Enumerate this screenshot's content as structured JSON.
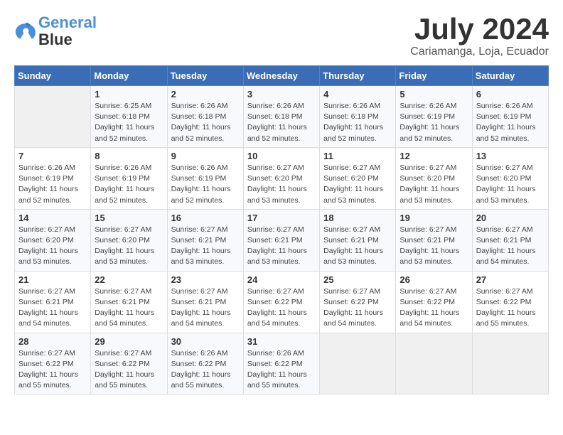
{
  "header": {
    "logo_line1": "General",
    "logo_line2": "Blue",
    "title": "July 2024",
    "location": "Cariamanga, Loja, Ecuador"
  },
  "days_of_week": [
    "Sunday",
    "Monday",
    "Tuesday",
    "Wednesday",
    "Thursday",
    "Friday",
    "Saturday"
  ],
  "weeks": [
    [
      {
        "num": "",
        "info": ""
      },
      {
        "num": "1",
        "info": "Sunrise: 6:25 AM\nSunset: 6:18 PM\nDaylight: 11 hours\nand 52 minutes."
      },
      {
        "num": "2",
        "info": "Sunrise: 6:26 AM\nSunset: 6:18 PM\nDaylight: 11 hours\nand 52 minutes."
      },
      {
        "num": "3",
        "info": "Sunrise: 6:26 AM\nSunset: 6:18 PM\nDaylight: 11 hours\nand 52 minutes."
      },
      {
        "num": "4",
        "info": "Sunrise: 6:26 AM\nSunset: 6:18 PM\nDaylight: 11 hours\nand 52 minutes."
      },
      {
        "num": "5",
        "info": "Sunrise: 6:26 AM\nSunset: 6:19 PM\nDaylight: 11 hours\nand 52 minutes."
      },
      {
        "num": "6",
        "info": "Sunrise: 6:26 AM\nSunset: 6:19 PM\nDaylight: 11 hours\nand 52 minutes."
      }
    ],
    [
      {
        "num": "7",
        "info": "Sunrise: 6:26 AM\nSunset: 6:19 PM\nDaylight: 11 hours\nand 52 minutes."
      },
      {
        "num": "8",
        "info": "Sunrise: 6:26 AM\nSunset: 6:19 PM\nDaylight: 11 hours\nand 52 minutes."
      },
      {
        "num": "9",
        "info": "Sunrise: 6:26 AM\nSunset: 6:19 PM\nDaylight: 11 hours\nand 52 minutes."
      },
      {
        "num": "10",
        "info": "Sunrise: 6:27 AM\nSunset: 6:20 PM\nDaylight: 11 hours\nand 53 minutes."
      },
      {
        "num": "11",
        "info": "Sunrise: 6:27 AM\nSunset: 6:20 PM\nDaylight: 11 hours\nand 53 minutes."
      },
      {
        "num": "12",
        "info": "Sunrise: 6:27 AM\nSunset: 6:20 PM\nDaylight: 11 hours\nand 53 minutes."
      },
      {
        "num": "13",
        "info": "Sunrise: 6:27 AM\nSunset: 6:20 PM\nDaylight: 11 hours\nand 53 minutes."
      }
    ],
    [
      {
        "num": "14",
        "info": "Sunrise: 6:27 AM\nSunset: 6:20 PM\nDaylight: 11 hours\nand 53 minutes."
      },
      {
        "num": "15",
        "info": "Sunrise: 6:27 AM\nSunset: 6:20 PM\nDaylight: 11 hours\nand 53 minutes."
      },
      {
        "num": "16",
        "info": "Sunrise: 6:27 AM\nSunset: 6:21 PM\nDaylight: 11 hours\nand 53 minutes."
      },
      {
        "num": "17",
        "info": "Sunrise: 6:27 AM\nSunset: 6:21 PM\nDaylight: 11 hours\nand 53 minutes."
      },
      {
        "num": "18",
        "info": "Sunrise: 6:27 AM\nSunset: 6:21 PM\nDaylight: 11 hours\nand 53 minutes."
      },
      {
        "num": "19",
        "info": "Sunrise: 6:27 AM\nSunset: 6:21 PM\nDaylight: 11 hours\nand 53 minutes."
      },
      {
        "num": "20",
        "info": "Sunrise: 6:27 AM\nSunset: 6:21 PM\nDaylight: 11 hours\nand 54 minutes."
      }
    ],
    [
      {
        "num": "21",
        "info": "Sunrise: 6:27 AM\nSunset: 6:21 PM\nDaylight: 11 hours\nand 54 minutes."
      },
      {
        "num": "22",
        "info": "Sunrise: 6:27 AM\nSunset: 6:21 PM\nDaylight: 11 hours\nand 54 minutes."
      },
      {
        "num": "23",
        "info": "Sunrise: 6:27 AM\nSunset: 6:21 PM\nDaylight: 11 hours\nand 54 minutes."
      },
      {
        "num": "24",
        "info": "Sunrise: 6:27 AM\nSunset: 6:22 PM\nDaylight: 11 hours\nand 54 minutes."
      },
      {
        "num": "25",
        "info": "Sunrise: 6:27 AM\nSunset: 6:22 PM\nDaylight: 11 hours\nand 54 minutes."
      },
      {
        "num": "26",
        "info": "Sunrise: 6:27 AM\nSunset: 6:22 PM\nDaylight: 11 hours\nand 54 minutes."
      },
      {
        "num": "27",
        "info": "Sunrise: 6:27 AM\nSunset: 6:22 PM\nDaylight: 11 hours\nand 55 minutes."
      }
    ],
    [
      {
        "num": "28",
        "info": "Sunrise: 6:27 AM\nSunset: 6:22 PM\nDaylight: 11 hours\nand 55 minutes."
      },
      {
        "num": "29",
        "info": "Sunrise: 6:27 AM\nSunset: 6:22 PM\nDaylight: 11 hours\nand 55 minutes."
      },
      {
        "num": "30",
        "info": "Sunrise: 6:26 AM\nSunset: 6:22 PM\nDaylight: 11 hours\nand 55 minutes."
      },
      {
        "num": "31",
        "info": "Sunrise: 6:26 AM\nSunset: 6:22 PM\nDaylight: 11 hours\nand 55 minutes."
      },
      {
        "num": "",
        "info": ""
      },
      {
        "num": "",
        "info": ""
      },
      {
        "num": "",
        "info": ""
      }
    ]
  ]
}
